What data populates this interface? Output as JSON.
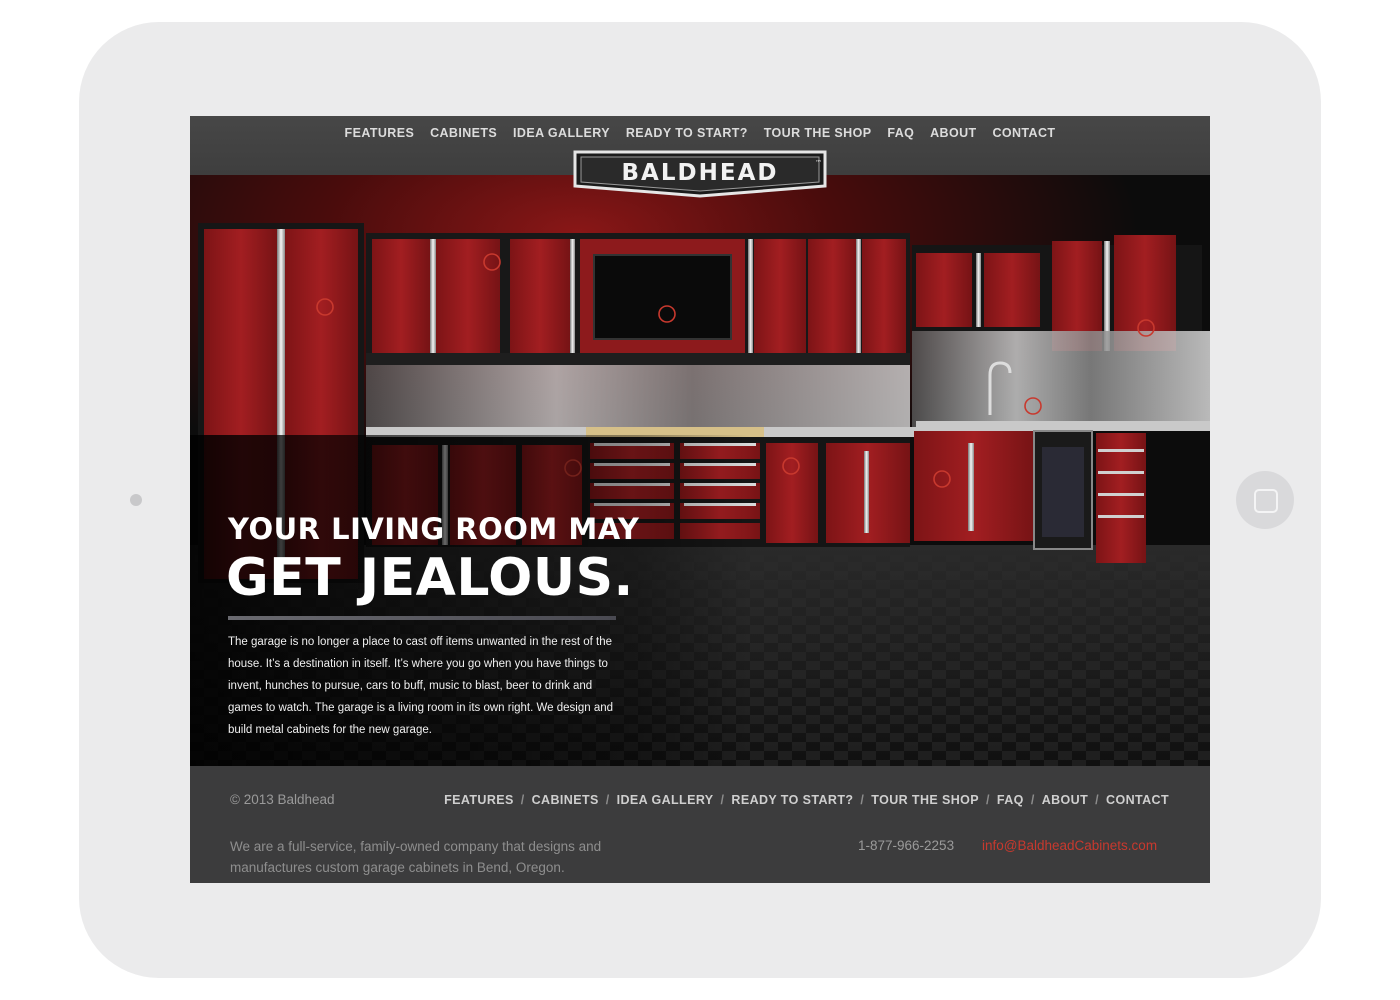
{
  "nav": {
    "items": [
      "FEATURES",
      "CABINETS",
      "IDEA GALLERY",
      "READY TO START?",
      "TOUR THE SHOP",
      "FAQ",
      "ABOUT",
      "CONTACT"
    ]
  },
  "logo": {
    "text": "BALDHEAD",
    "tm": "™"
  },
  "hero": {
    "headline_line1": "YOUR LIVING ROOM MAY",
    "headline_line2": "GET JEALOUS.",
    "body": "The garage is no longer a place to cast off items unwanted in the rest of the house. It’s a destination in itself. It’s where you go when you have things to invent, hunches to pursue, cars to buff, music to blast, beer to drink and games to watch. The garage is a living room in its own right. We design and build metal cabinets for the new garage.",
    "hotspot_icon": "menu-circle-icon"
  },
  "footer": {
    "copyright": "© 2013 Baldhead",
    "nav": [
      "FEATURES",
      "CABINETS",
      "IDEA GALLERY",
      "READY TO START?",
      "TOUR THE SHOP",
      "FAQ",
      "ABOUT",
      "CONTACT"
    ],
    "separator": "/",
    "about": "We are a full-service, family-owned company that designs and manufactures custom garage cabinets in Bend, Oregon.",
    "phone": "1-877-966-2253",
    "email": "info@BaldheadCabinets.com"
  },
  "colors": {
    "accent": "#c8392e",
    "cabinet_red": "#8e1a1c",
    "topbar": "#424242",
    "footer": "#3c3c3d"
  }
}
